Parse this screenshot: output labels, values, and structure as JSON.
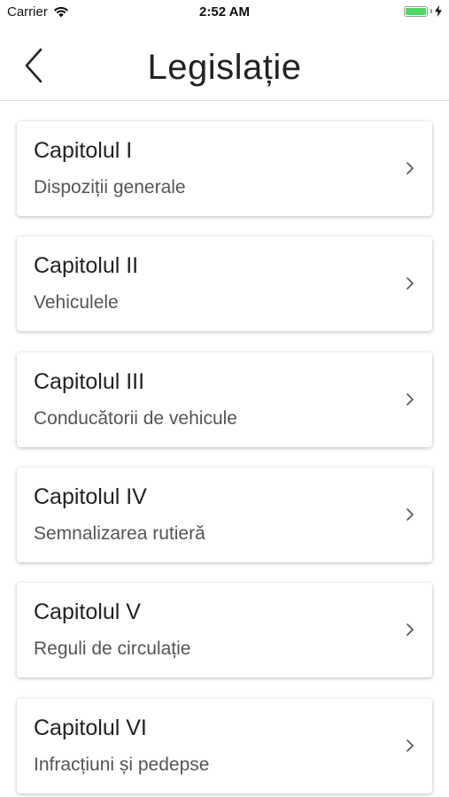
{
  "status_bar": {
    "carrier": "Carrier",
    "wifi_icon": "wifi-icon",
    "time": "2:52 AM",
    "battery_icon": "battery-full-icon",
    "battery_level": 1.0,
    "charging_icon": "bolt-icon",
    "battery_color": "#4cd964"
  },
  "nav": {
    "back_icon": "chevron-left-icon",
    "title": "Legislație"
  },
  "chapters": [
    {
      "title": "Capitolul I",
      "subtitle": "Dispoziții generale"
    },
    {
      "title": "Capitolul II",
      "subtitle": "Vehiculele"
    },
    {
      "title": "Capitolul III",
      "subtitle": "Conducătorii de vehicule"
    },
    {
      "title": "Capitolul IV",
      "subtitle": "Semnalizarea rutieră"
    },
    {
      "title": "Capitolul V",
      "subtitle": "Reguli de circulație"
    },
    {
      "title": "Capitolul VI",
      "subtitle": "Infracțiuni și pedepse"
    }
  ],
  "row_icon": "chevron-right-icon"
}
